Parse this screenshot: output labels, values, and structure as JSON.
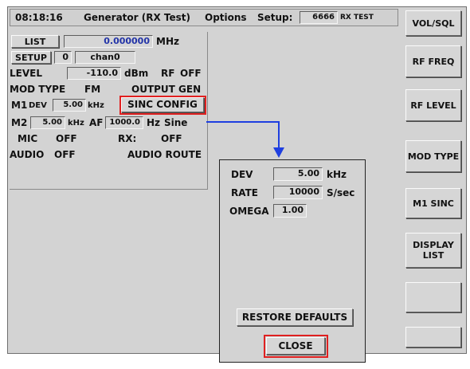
{
  "header": {
    "time": "08:18:16",
    "title": "Generator (RX Test)",
    "options": "Options",
    "setup_label": "Setup:",
    "setup_value": "6666",
    "setup_name": "RX TEST"
  },
  "panel": {
    "list_button": "LIST",
    "list_value": "0.000000",
    "list_unit": "MHz",
    "setup_button": "SETUP",
    "setup_index": "0",
    "setup_channel": "chan0",
    "level_label": "LEVEL",
    "level_value": "-110.0",
    "level_unit": "dBm",
    "rf_label": "RF",
    "rf_state": "OFF",
    "mod_type_label": "MOD TYPE",
    "mod_type_value": "FM",
    "output_gen": "OUTPUT GEN",
    "m1_label": "M1",
    "m1_dev_label": "DEV",
    "m1_dev_value": "5.00",
    "m1_dev_unit": "kHz",
    "sinc_config": "SINC CONFIG",
    "m2_label": "M2",
    "m2_dev_value": "5.00",
    "m2_dev_unit": "kHz",
    "af_label": "AF",
    "af_value": "1000.0",
    "af_unit": "Hz",
    "waveform": "Sine",
    "mic_label": "MIC",
    "mic_state": "OFF",
    "rx_label": "RX:",
    "rx_state": "OFF",
    "audio_label": "AUDIO",
    "audio_state": "OFF",
    "audio_route": "AUDIO ROUTE"
  },
  "popup": {
    "dev_label": "DEV",
    "dev_value": "5.00",
    "dev_unit": "kHz",
    "rate_label": "RATE",
    "rate_value": "10000",
    "rate_unit": "S/sec",
    "omega_label": "OMEGA",
    "omega_value": "1.00",
    "restore_defaults": "RESTORE DEFAULTS",
    "close": "CLOSE"
  },
  "softkeys": [
    {
      "label": "VOL/SQL"
    },
    {
      "label": "RF FREQ"
    },
    {
      "label": "RF LEVEL"
    },
    {
      "label": "MOD TYPE"
    },
    {
      "label": "M1 SINC"
    },
    {
      "label": "DISPLAY\nLIST"
    },
    {
      "label": ""
    },
    {
      "label": ""
    }
  ],
  "colors": {
    "highlight": "#e02020",
    "connector": "#1f3fe0"
  }
}
